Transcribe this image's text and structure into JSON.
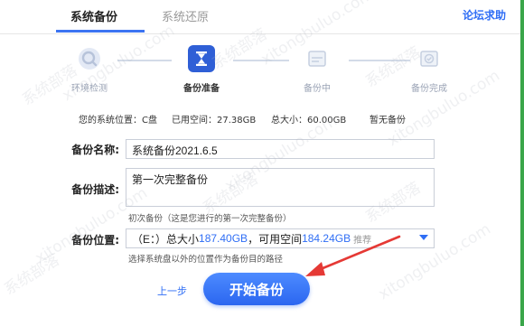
{
  "tabs": {
    "backup": "系统备份",
    "restore": "系统还原",
    "help": "论坛求助"
  },
  "steps": [
    {
      "label": "环境检测",
      "state": "done",
      "icon": "search-icon"
    },
    {
      "label": "备份准备",
      "state": "active",
      "icon": "hourglass-icon"
    },
    {
      "label": "备份中",
      "state": "pending",
      "icon": "drive-icon"
    },
    {
      "label": "备份完成",
      "state": "pending",
      "icon": "check-icon"
    }
  ],
  "info": {
    "location": "您的系统位置：C盘",
    "used": "已用空间：27.38GB",
    "total": "总大小：60.00GB",
    "backups": "暂无备份"
  },
  "form": {
    "name_label": "备份名称:",
    "name_value": "系统备份2021.6.5",
    "desc_label": "备份描述:",
    "desc_value": "第一次完整备份",
    "desc_hint": "初次备份（这是您进行的第一次完整备份）",
    "location_label": "备份位置:",
    "location_drive": "（E：）总大小",
    "location_total": "187.40GB",
    "location_free_label": "，可用空间",
    "location_free": "184.24GB",
    "location_tag": "推荐",
    "location_hint": "选择系统盘以外的位置作为备份目的路径"
  },
  "actions": {
    "prev": "上一步",
    "start": "开始备份"
  },
  "watermark": {
    "text_cn": "系统部落",
    "text_en": "xitongbuluo.com"
  },
  "colors": {
    "accent": "#2f6ef5",
    "annotation_arrow": "#e53935"
  }
}
